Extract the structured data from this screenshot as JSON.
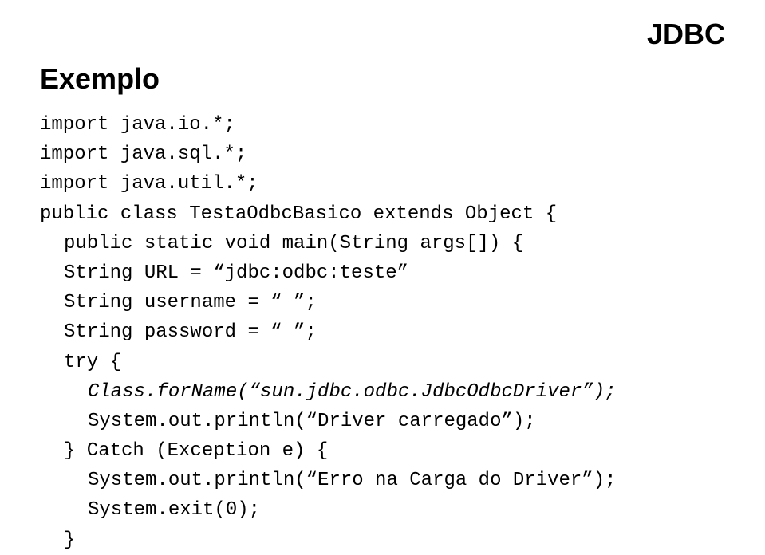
{
  "header": {
    "label": "JDBC"
  },
  "section": {
    "title": "Exemplo"
  },
  "code": {
    "lines": [
      {
        "text": "import java.io.*;",
        "indent": 0,
        "italic": false
      },
      {
        "text": "import java.sql.*;",
        "indent": 0,
        "italic": false
      },
      {
        "text": "import java.util.*;",
        "indent": 0,
        "italic": false
      },
      {
        "text": "public class TestaOdbcBasico extends Object {",
        "indent": 0,
        "italic": false
      },
      {
        "text": "public static void main(String args[]) {",
        "indent": 1,
        "italic": false
      },
      {
        "text": "String URL = “jdbc:odbc:teste”",
        "indent": 1,
        "italic": false
      },
      {
        "text": "String username = “ ”;",
        "indent": 1,
        "italic": false
      },
      {
        "text": "String password = “ ”;",
        "indent": 1,
        "italic": false
      },
      {
        "text": "try {",
        "indent": 1,
        "italic": false
      },
      {
        "text": "Class.forName(“sun.jdbc.odbc.JdbcOdbcDriver”);",
        "indent": 2,
        "italic": true
      },
      {
        "text": "System.out.println(“Driver carregado”);",
        "indent": 2,
        "italic": false
      },
      {
        "text": "} Catch (Exception e) {",
        "indent": 1,
        "italic": false
      },
      {
        "text": "System.out.println(“Erro na Carga do Driver”);",
        "indent": 2,
        "italic": false
      },
      {
        "text": "System.exit(0);",
        "indent": 2,
        "italic": false
      },
      {
        "text": "}",
        "indent": 1,
        "italic": false
      }
    ]
  }
}
